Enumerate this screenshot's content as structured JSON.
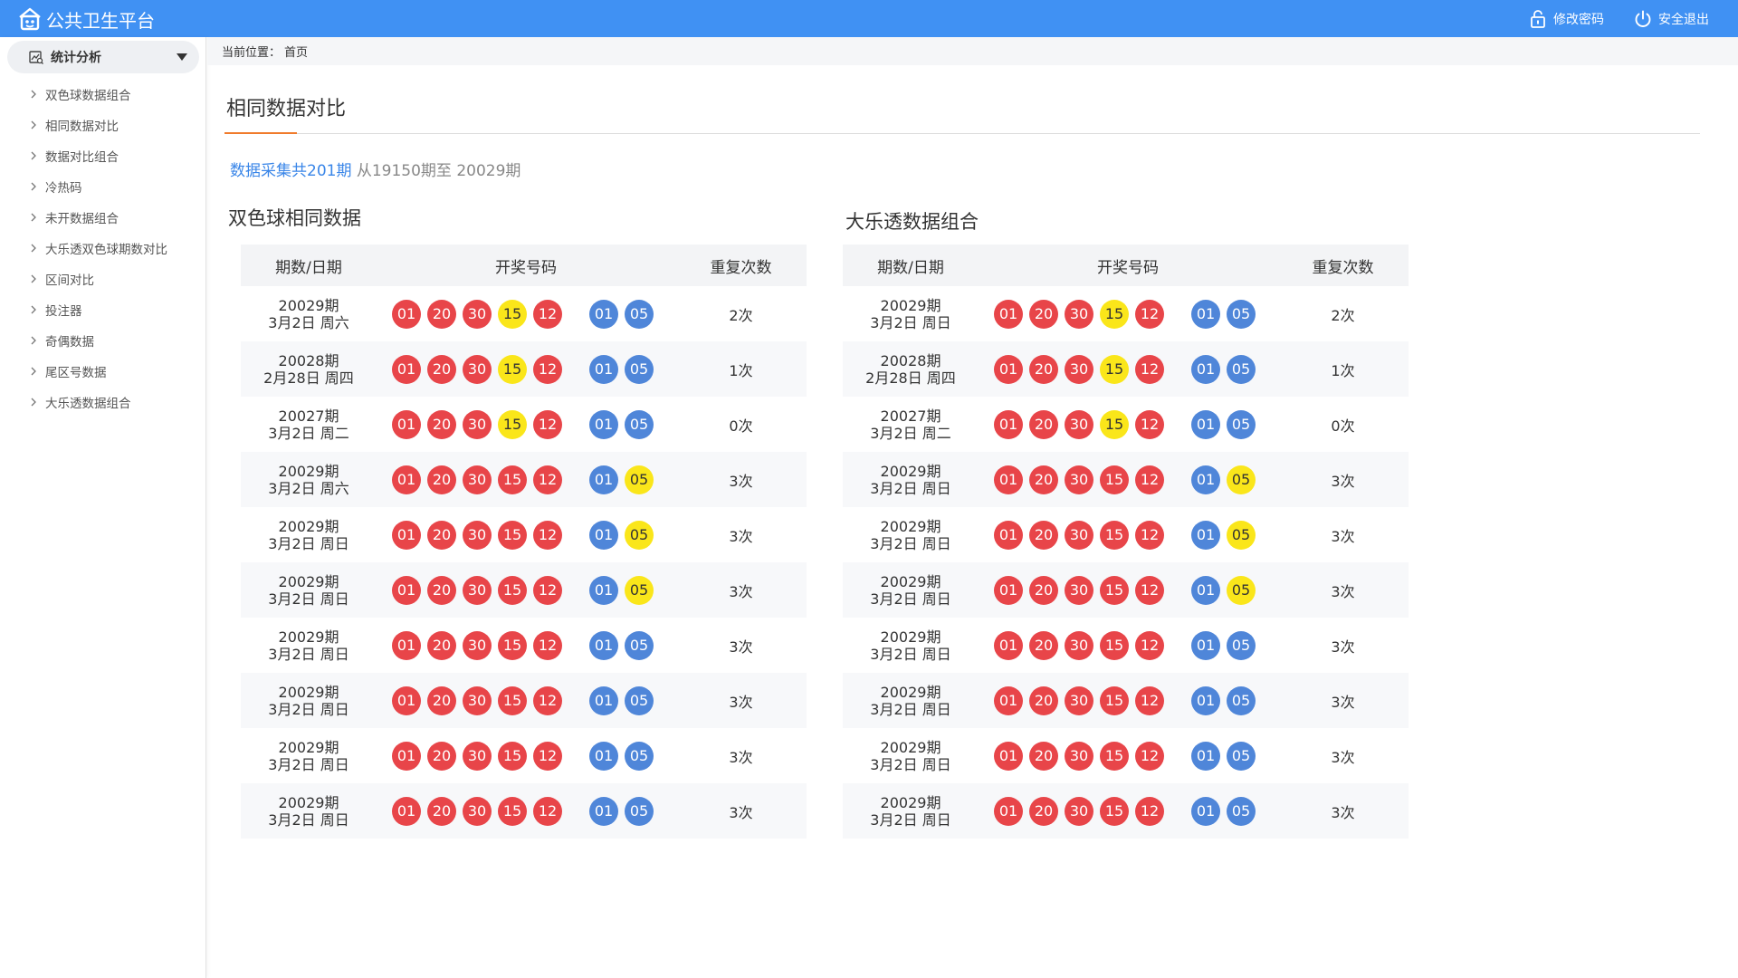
{
  "app": {
    "title": "公共卫生平台"
  },
  "top_actions": {
    "change_password": "修改密码",
    "logout": "安全退出"
  },
  "sidebar": {
    "group_label": "统计分析",
    "items": [
      {
        "label": "双色球数据组合"
      },
      {
        "label": "相同数据对比"
      },
      {
        "label": "数据对比组合"
      },
      {
        "label": "冷热码"
      },
      {
        "label": "未开数据组合"
      },
      {
        "label": "大乐透双色球期数对比"
      },
      {
        "label": "区间对比"
      },
      {
        "label": "投注器"
      },
      {
        "label": "奇偶数据"
      },
      {
        "label": "尾区号数据"
      },
      {
        "label": "大乐透数据组合"
      }
    ]
  },
  "breadcrumb": {
    "label": "当前位置：",
    "current": "首页"
  },
  "page": {
    "title": "相同数据对比",
    "summary_highlight": "数据采集共201期",
    "summary_rest": " 从19150期至 20029期"
  },
  "colors": {
    "red": "#e84549",
    "blue": "#4f86d9",
    "yellow": "#fae61a",
    "accent": "#f07b2c",
    "topbar": "#4091f3"
  },
  "tables": [
    {
      "title": "双色球相同数据",
      "headers": {
        "date": "期数/日期",
        "balls": "开奖号码",
        "count": "重复次数"
      },
      "rows": [
        {
          "period": "20029期",
          "date": "3月2日 周六",
          "front": [
            "01",
            "20",
            "30",
            "15",
            "12"
          ],
          "front_colors": [
            "red",
            "red",
            "red",
            "yellow",
            "red"
          ],
          "back": [
            "01",
            "05"
          ],
          "back_colors": [
            "blue",
            "blue"
          ],
          "count": "2次"
        },
        {
          "period": "20028期",
          "date": "2月28日 周四",
          "front": [
            "01",
            "20",
            "30",
            "15",
            "12"
          ],
          "front_colors": [
            "red",
            "red",
            "red",
            "yellow",
            "red"
          ],
          "back": [
            "01",
            "05"
          ],
          "back_colors": [
            "blue",
            "blue"
          ],
          "count": "1次"
        },
        {
          "period": "20027期",
          "date": "3月2日 周二",
          "front": [
            "01",
            "20",
            "30",
            "15",
            "12"
          ],
          "front_colors": [
            "red",
            "red",
            "red",
            "yellow",
            "red"
          ],
          "back": [
            "01",
            "05"
          ],
          "back_colors": [
            "blue",
            "blue"
          ],
          "count": "0次"
        },
        {
          "period": "20029期",
          "date": "3月2日 周六",
          "front": [
            "01",
            "20",
            "30",
            "15",
            "12"
          ],
          "front_colors": [
            "red",
            "red",
            "red",
            "red",
            "red"
          ],
          "back": [
            "01",
            "05"
          ],
          "back_colors": [
            "blue",
            "yellow"
          ],
          "count": "3次"
        },
        {
          "period": "20029期",
          "date": "3月2日 周日",
          "front": [
            "01",
            "20",
            "30",
            "15",
            "12"
          ],
          "front_colors": [
            "red",
            "red",
            "red",
            "red",
            "red"
          ],
          "back": [
            "01",
            "05"
          ],
          "back_colors": [
            "blue",
            "yellow"
          ],
          "count": "3次"
        },
        {
          "period": "20029期",
          "date": "3月2日 周日",
          "front": [
            "01",
            "20",
            "30",
            "15",
            "12"
          ],
          "front_colors": [
            "red",
            "red",
            "red",
            "red",
            "red"
          ],
          "back": [
            "01",
            "05"
          ],
          "back_colors": [
            "blue",
            "yellow"
          ],
          "count": "3次"
        },
        {
          "period": "20029期",
          "date": "3月2日 周日",
          "front": [
            "01",
            "20",
            "30",
            "15",
            "12"
          ],
          "front_colors": [
            "red",
            "red",
            "red",
            "red",
            "red"
          ],
          "back": [
            "01",
            "05"
          ],
          "back_colors": [
            "blue",
            "blue"
          ],
          "count": "3次"
        },
        {
          "period": "20029期",
          "date": "3月2日 周日",
          "front": [
            "01",
            "20",
            "30",
            "15",
            "12"
          ],
          "front_colors": [
            "red",
            "red",
            "red",
            "red",
            "red"
          ],
          "back": [
            "01",
            "05"
          ],
          "back_colors": [
            "blue",
            "blue"
          ],
          "count": "3次"
        },
        {
          "period": "20029期",
          "date": "3月2日 周日",
          "front": [
            "01",
            "20",
            "30",
            "15",
            "12"
          ],
          "front_colors": [
            "red",
            "red",
            "red",
            "red",
            "red"
          ],
          "back": [
            "01",
            "05"
          ],
          "back_colors": [
            "blue",
            "blue"
          ],
          "count": "3次"
        },
        {
          "period": "20029期",
          "date": "3月2日 周日",
          "front": [
            "01",
            "20",
            "30",
            "15",
            "12"
          ],
          "front_colors": [
            "red",
            "red",
            "red",
            "red",
            "red"
          ],
          "back": [
            "01",
            "05"
          ],
          "back_colors": [
            "blue",
            "blue"
          ],
          "count": "3次"
        }
      ]
    },
    {
      "title": "大乐透数据组合",
      "headers": {
        "date": "期数/日期",
        "balls": "开奖号码",
        "count": "重复次数"
      },
      "rows": [
        {
          "period": "20029期",
          "date": "3月2日 周日",
          "front": [
            "01",
            "20",
            "30",
            "15",
            "12"
          ],
          "front_colors": [
            "red",
            "red",
            "red",
            "yellow",
            "red"
          ],
          "back": [
            "01",
            "05"
          ],
          "back_colors": [
            "blue",
            "blue"
          ],
          "count": "2次"
        },
        {
          "period": "20028期",
          "date": "2月28日 周四",
          "front": [
            "01",
            "20",
            "30",
            "15",
            "12"
          ],
          "front_colors": [
            "red",
            "red",
            "red",
            "yellow",
            "red"
          ],
          "back": [
            "01",
            "05"
          ],
          "back_colors": [
            "blue",
            "blue"
          ],
          "count": "1次"
        },
        {
          "period": "20027期",
          "date": "3月2日 周二",
          "front": [
            "01",
            "20",
            "30",
            "15",
            "12"
          ],
          "front_colors": [
            "red",
            "red",
            "red",
            "yellow",
            "red"
          ],
          "back": [
            "01",
            "05"
          ],
          "back_colors": [
            "blue",
            "blue"
          ],
          "count": "0次"
        },
        {
          "period": "20029期",
          "date": "3月2日 周日",
          "front": [
            "01",
            "20",
            "30",
            "15",
            "12"
          ],
          "front_colors": [
            "red",
            "red",
            "red",
            "red",
            "red"
          ],
          "back": [
            "01",
            "05"
          ],
          "back_colors": [
            "blue",
            "yellow"
          ],
          "count": "3次"
        },
        {
          "period": "20029期",
          "date": "3月2日 周日",
          "front": [
            "01",
            "20",
            "30",
            "15",
            "12"
          ],
          "front_colors": [
            "red",
            "red",
            "red",
            "red",
            "red"
          ],
          "back": [
            "01",
            "05"
          ],
          "back_colors": [
            "blue",
            "yellow"
          ],
          "count": "3次"
        },
        {
          "period": "20029期",
          "date": "3月2日 周日",
          "front": [
            "01",
            "20",
            "30",
            "15",
            "12"
          ],
          "front_colors": [
            "red",
            "red",
            "red",
            "red",
            "red"
          ],
          "back": [
            "01",
            "05"
          ],
          "back_colors": [
            "blue",
            "yellow"
          ],
          "count": "3次"
        },
        {
          "period": "20029期",
          "date": "3月2日 周日",
          "front": [
            "01",
            "20",
            "30",
            "15",
            "12"
          ],
          "front_colors": [
            "red",
            "red",
            "red",
            "red",
            "red"
          ],
          "back": [
            "01",
            "05"
          ],
          "back_colors": [
            "blue",
            "blue"
          ],
          "count": "3次"
        },
        {
          "period": "20029期",
          "date": "3月2日 周日",
          "front": [
            "01",
            "20",
            "30",
            "15",
            "12"
          ],
          "front_colors": [
            "red",
            "red",
            "red",
            "red",
            "red"
          ],
          "back": [
            "01",
            "05"
          ],
          "back_colors": [
            "blue",
            "blue"
          ],
          "count": "3次"
        },
        {
          "period": "20029期",
          "date": "3月2日 周日",
          "front": [
            "01",
            "20",
            "30",
            "15",
            "12"
          ],
          "front_colors": [
            "red",
            "red",
            "red",
            "red",
            "red"
          ],
          "back": [
            "01",
            "05"
          ],
          "back_colors": [
            "blue",
            "blue"
          ],
          "count": "3次"
        },
        {
          "period": "20029期",
          "date": "3月2日 周日",
          "front": [
            "01",
            "20",
            "30",
            "15",
            "12"
          ],
          "front_colors": [
            "red",
            "red",
            "red",
            "red",
            "red"
          ],
          "back": [
            "01",
            "05"
          ],
          "back_colors": [
            "blue",
            "blue"
          ],
          "count": "3次"
        }
      ]
    }
  ]
}
